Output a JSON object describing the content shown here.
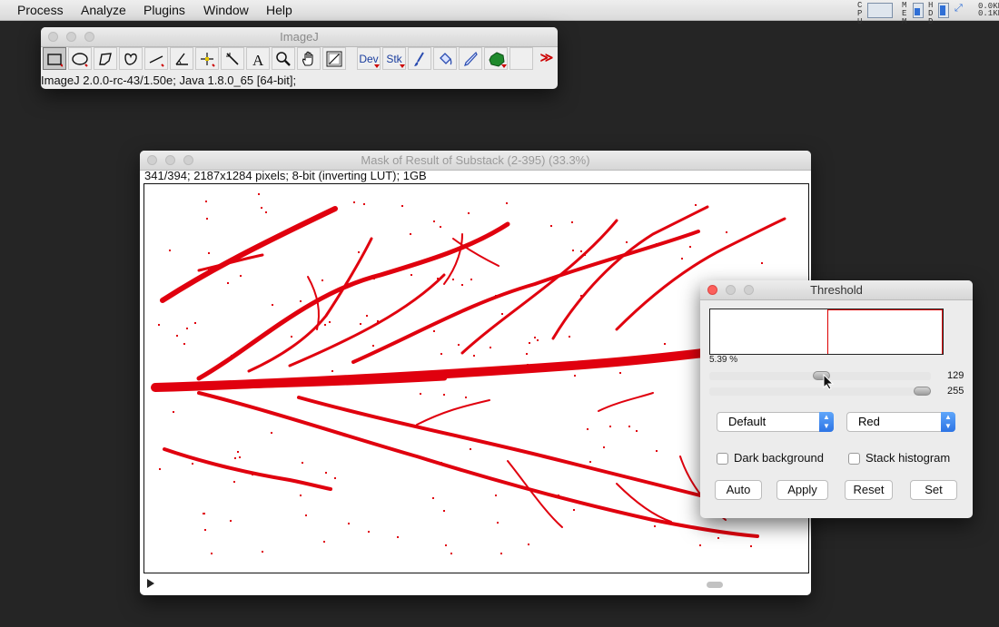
{
  "menubar": {
    "items": [
      "Process",
      "Analyze",
      "Plugins",
      "Window",
      "Help"
    ],
    "sys_labels": {
      "cpu": "CPU",
      "mem": "MEM",
      "hdd": "HDD",
      "net_up": "0.0KB",
      "net_down": "0.1KB"
    }
  },
  "imagej": {
    "title": "ImageJ",
    "tools": [
      {
        "icon": "rectangle-selection-icon"
      },
      {
        "icon": "oval-selection-icon"
      },
      {
        "icon": "polygon-selection-icon"
      },
      {
        "icon": "freehand-selection-icon"
      },
      {
        "icon": "line-selection-icon"
      },
      {
        "icon": "angle-tool-icon"
      },
      {
        "icon": "point-tool-icon"
      },
      {
        "icon": "wand-tool-icon"
      },
      {
        "icon": "text-tool-icon",
        "label": "A"
      },
      {
        "icon": "magnifying-glass-icon"
      },
      {
        "icon": "hand-scroll-icon"
      },
      {
        "icon": "color-picker-icon"
      },
      {
        "icon": "developer-menu-icon",
        "label": "Dev"
      },
      {
        "icon": "stack-tools-icon",
        "label": "Stk"
      },
      {
        "icon": "brush-tool-icon"
      },
      {
        "icon": "flood-fill-icon"
      },
      {
        "icon": "pencil-tool-icon"
      },
      {
        "icon": "plugin-blob-icon"
      },
      {
        "icon": "empty-slot-icon"
      },
      {
        "icon": "more-tools-icon",
        "label": "≫"
      }
    ],
    "status": "ImageJ 2.0.0-rc-43/1.50e; Java 1.8.0_65 [64-bit];"
  },
  "image_window": {
    "title": "Mask of Result of Substack (2-395) (33.3%)",
    "info": "341/394; 2187x1284 pixels; 8-bit (inverting LUT); 1GB",
    "threshold_color": "#e0000e",
    "slice_scroll": {
      "current": 341,
      "total": 394
    }
  },
  "threshold": {
    "title": "Threshold",
    "percent": "5.39 %",
    "lower_value": "129",
    "upper_value": "255",
    "lower_fraction": 0.506,
    "upper_fraction": 1.0,
    "method": "Default",
    "mode": "Red",
    "dark_background_label": "Dark background",
    "dark_background": false,
    "stack_histogram_label": "Stack histogram",
    "stack_histogram": false,
    "buttons": {
      "auto": "Auto",
      "apply": "Apply",
      "reset": "Reset",
      "set": "Set"
    }
  }
}
